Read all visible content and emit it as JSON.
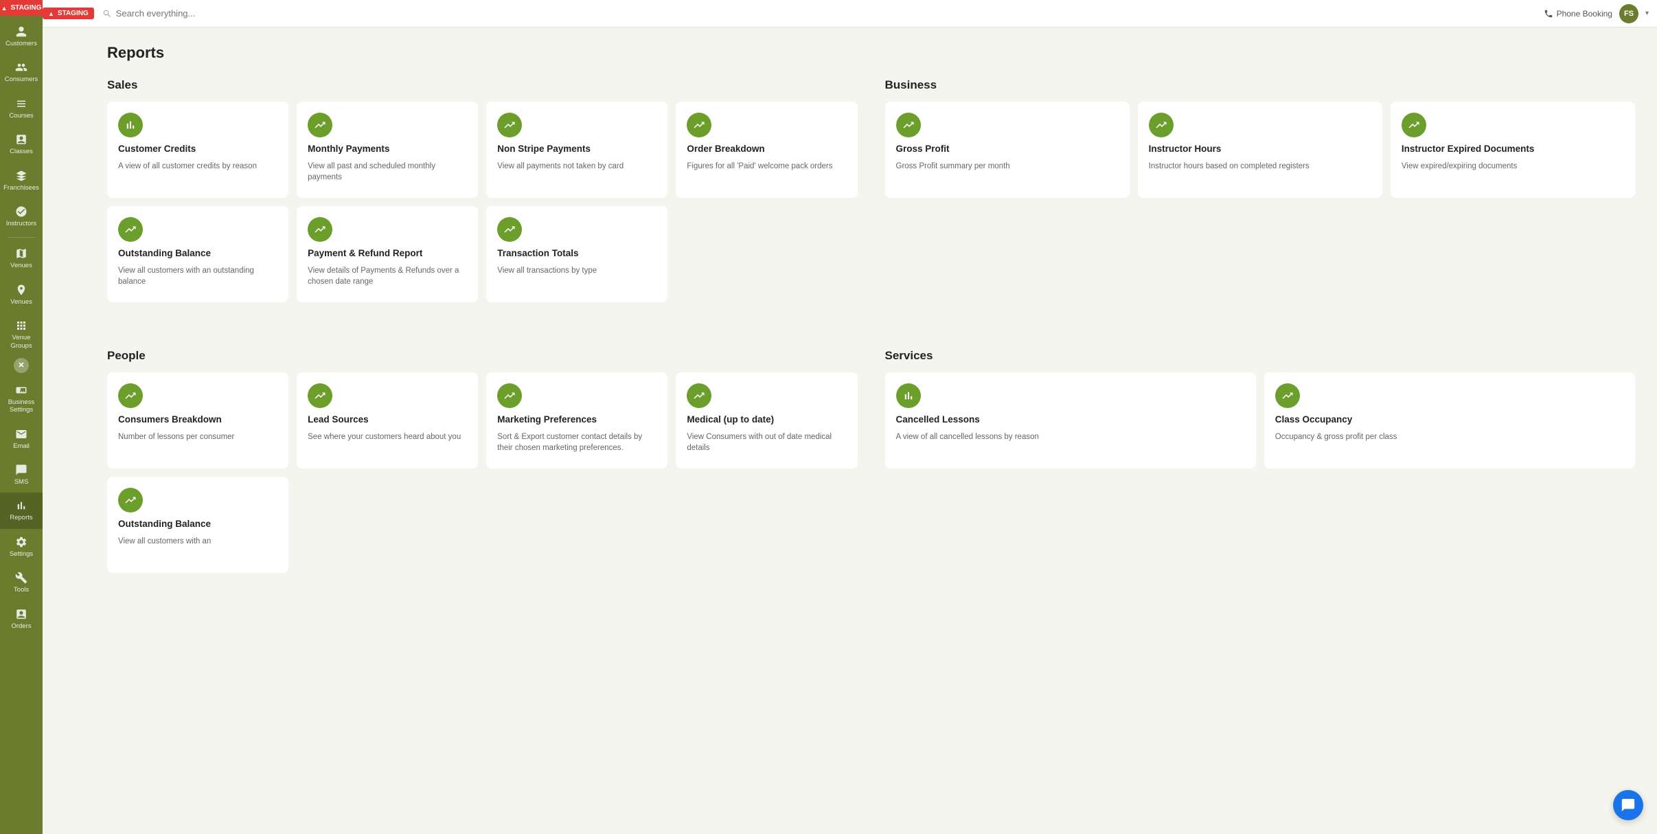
{
  "staging": {
    "label": "STAGING"
  },
  "search": {
    "placeholder": "Search everything..."
  },
  "topbar": {
    "phone_booking": "Phone Booking",
    "avatar_initials": "FS",
    "chevron": "▾"
  },
  "sidebar": {
    "items": [
      {
        "id": "customers",
        "label": "Customers",
        "icon": "person"
      },
      {
        "id": "consumers",
        "label": "Consumers",
        "icon": "group"
      },
      {
        "id": "courses",
        "label": "Courses",
        "icon": "grid"
      },
      {
        "id": "classes",
        "label": "Classes",
        "icon": "calendar"
      },
      {
        "id": "franchisees",
        "label": "Franchisees",
        "icon": "building"
      },
      {
        "id": "instructors",
        "label": "Instructors",
        "icon": "person-star"
      },
      {
        "id": "venues-map",
        "label": "Venues",
        "icon": "map"
      },
      {
        "id": "venues",
        "label": "Venues",
        "icon": "location"
      },
      {
        "id": "venue-groups",
        "label": "Venue Groups",
        "icon": "layers"
      },
      {
        "id": "business-settings",
        "label": "Business Settings",
        "icon": "settings-briefcase"
      },
      {
        "id": "email",
        "label": "Email",
        "icon": "email"
      },
      {
        "id": "sms",
        "label": "SMS",
        "icon": "chat"
      },
      {
        "id": "reports",
        "label": "Reports",
        "icon": "chart",
        "active": true
      },
      {
        "id": "settings",
        "label": "Settings",
        "icon": "gear"
      },
      {
        "id": "tools",
        "label": "Tools",
        "icon": "wrench"
      },
      {
        "id": "orders",
        "label": "Orders",
        "icon": "clipboard"
      }
    ]
  },
  "page": {
    "title": "Reports",
    "sections": {
      "sales": {
        "title": "Sales",
        "cards": [
          {
            "id": "customer-credits",
            "title": "Customer Credits",
            "desc": "A view of all customer credits by reason"
          },
          {
            "id": "monthly-payments",
            "title": "Monthly Payments",
            "desc": "View all past and scheduled monthly payments"
          },
          {
            "id": "non-stripe-payments",
            "title": "Non Stripe Payments",
            "desc": "View all payments not taken by card"
          },
          {
            "id": "order-breakdown",
            "title": "Order Breakdown",
            "desc": "Figures for all 'Paid' welcome pack orders"
          },
          {
            "id": "outstanding-balance",
            "title": "Outstanding Balance",
            "desc": "View all customers with an outstanding balance"
          },
          {
            "id": "payment-refund-report",
            "title": "Payment & Refund Report",
            "desc": "View details of Payments & Refunds over a chosen date range"
          },
          {
            "id": "transaction-totals",
            "title": "Transaction Totals",
            "desc": "View all transactions by type"
          }
        ]
      },
      "business": {
        "title": "Business",
        "cards": [
          {
            "id": "gross-profit",
            "title": "Gross Profit",
            "desc": "Gross Profit summary per month"
          },
          {
            "id": "instructor-hours",
            "title": "Instructor Hours",
            "desc": "Instructor hours based on completed registers"
          },
          {
            "id": "instructor-expired-docs",
            "title": "Instructor Expired Documents",
            "desc": "View expired/expiring documents"
          }
        ]
      },
      "people": {
        "title": "People",
        "cards": [
          {
            "id": "consumers-breakdown",
            "title": "Consumers Breakdown",
            "desc": "Number of lessons per consumer"
          },
          {
            "id": "lead-sources",
            "title": "Lead Sources",
            "desc": "See where your customers heard about you"
          },
          {
            "id": "marketing-preferences",
            "title": "Marketing Preferences",
            "desc": "Sort & Export customer contact details by their chosen marketing preferences."
          },
          {
            "id": "medical-up-to-date",
            "title": "Medical (up to date)",
            "desc": "View Consumers with out of date medical details"
          },
          {
            "id": "outstanding-balance-people",
            "title": "Outstanding Balance",
            "desc": "View all customers with an"
          }
        ]
      },
      "services": {
        "title": "Services",
        "cards": [
          {
            "id": "cancelled-lessons",
            "title": "Cancelled Lessons",
            "desc": "A view of all cancelled lessons by reason"
          },
          {
            "id": "class-occupancy",
            "title": "Class Occupancy",
            "desc": "Occupancy & gross profit per class"
          }
        ]
      }
    }
  }
}
